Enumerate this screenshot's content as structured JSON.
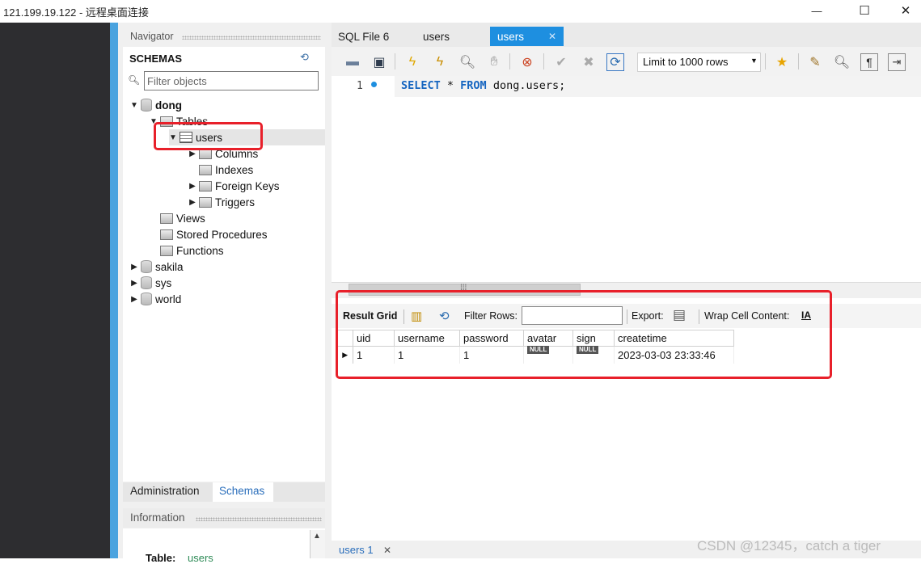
{
  "window": {
    "title": "121.199.19.122 - 远程桌面连接",
    "controls": {
      "minimize": "—",
      "maximize": "☐",
      "close": "✕"
    }
  },
  "navigator": {
    "title": "Navigator",
    "schemas_label": "SCHEMAS",
    "filter_placeholder": "Filter objects",
    "tree": [
      {
        "label": "dong",
        "expanded": true,
        "icon": "database-icon"
      },
      {
        "label": "Tables",
        "expanded": true,
        "icon": "folder-icon"
      },
      {
        "label": "users",
        "expanded": true,
        "icon": "table-icon"
      },
      {
        "label": "Columns",
        "expanded": false,
        "icon": "columns-icon"
      },
      {
        "label": "Indexes",
        "icon": "indexes-icon"
      },
      {
        "label": "Foreign Keys",
        "expanded": false,
        "icon": "foreign-keys-icon"
      },
      {
        "label": "Triggers",
        "expanded": false,
        "icon": "triggers-icon"
      },
      {
        "label": "Views",
        "icon": "folder-icon"
      },
      {
        "label": "Stored Procedures",
        "icon": "folder-icon"
      },
      {
        "label": "Functions",
        "icon": "folder-icon"
      },
      {
        "label": "sakila",
        "expanded": false,
        "icon": "database-icon"
      },
      {
        "label": "sys",
        "expanded": false,
        "icon": "database-icon"
      },
      {
        "label": "world",
        "expanded": false,
        "icon": "database-icon"
      }
    ],
    "bottom_tabs": {
      "administration": "Administration",
      "schemas": "Schemas"
    },
    "information": {
      "title": "Information",
      "table_label": "Table:",
      "table_name": "users"
    }
  },
  "editor": {
    "tabs": [
      {
        "label": "SQL File 6",
        "active": false
      },
      {
        "label": "users",
        "active": false
      },
      {
        "label": "users",
        "active": true,
        "close": "✕"
      }
    ],
    "limit_rows": "Limit to 1000 rows",
    "line_number": "1",
    "sql": {
      "kw1": "SELECT",
      "star": " * ",
      "kw2": "FROM",
      "rest": " dong.users;"
    }
  },
  "result": {
    "toolbar": {
      "grid_label": "Result Grid",
      "filter_label": "Filter Rows:",
      "filter_value": "",
      "export_label": "Export:",
      "wrap_label": "Wrap Cell Content:",
      "wrap_icon": "IA"
    },
    "columns": [
      "uid",
      "username",
      "password",
      "avatar",
      "sign",
      "createtime"
    ],
    "rows": [
      [
        "1",
        "1",
        "1",
        "NULL",
        "NULL",
        "2023-03-03 23:33:46"
      ]
    ]
  },
  "bottom_tab": {
    "label": "users 1",
    "close": "✕"
  },
  "watermark": "CSDN @12345，catch a tiger",
  "colors": {
    "accent": "#1e8fe0",
    "highlight_box": "#e8202a",
    "keyword": "#1565c0"
  }
}
